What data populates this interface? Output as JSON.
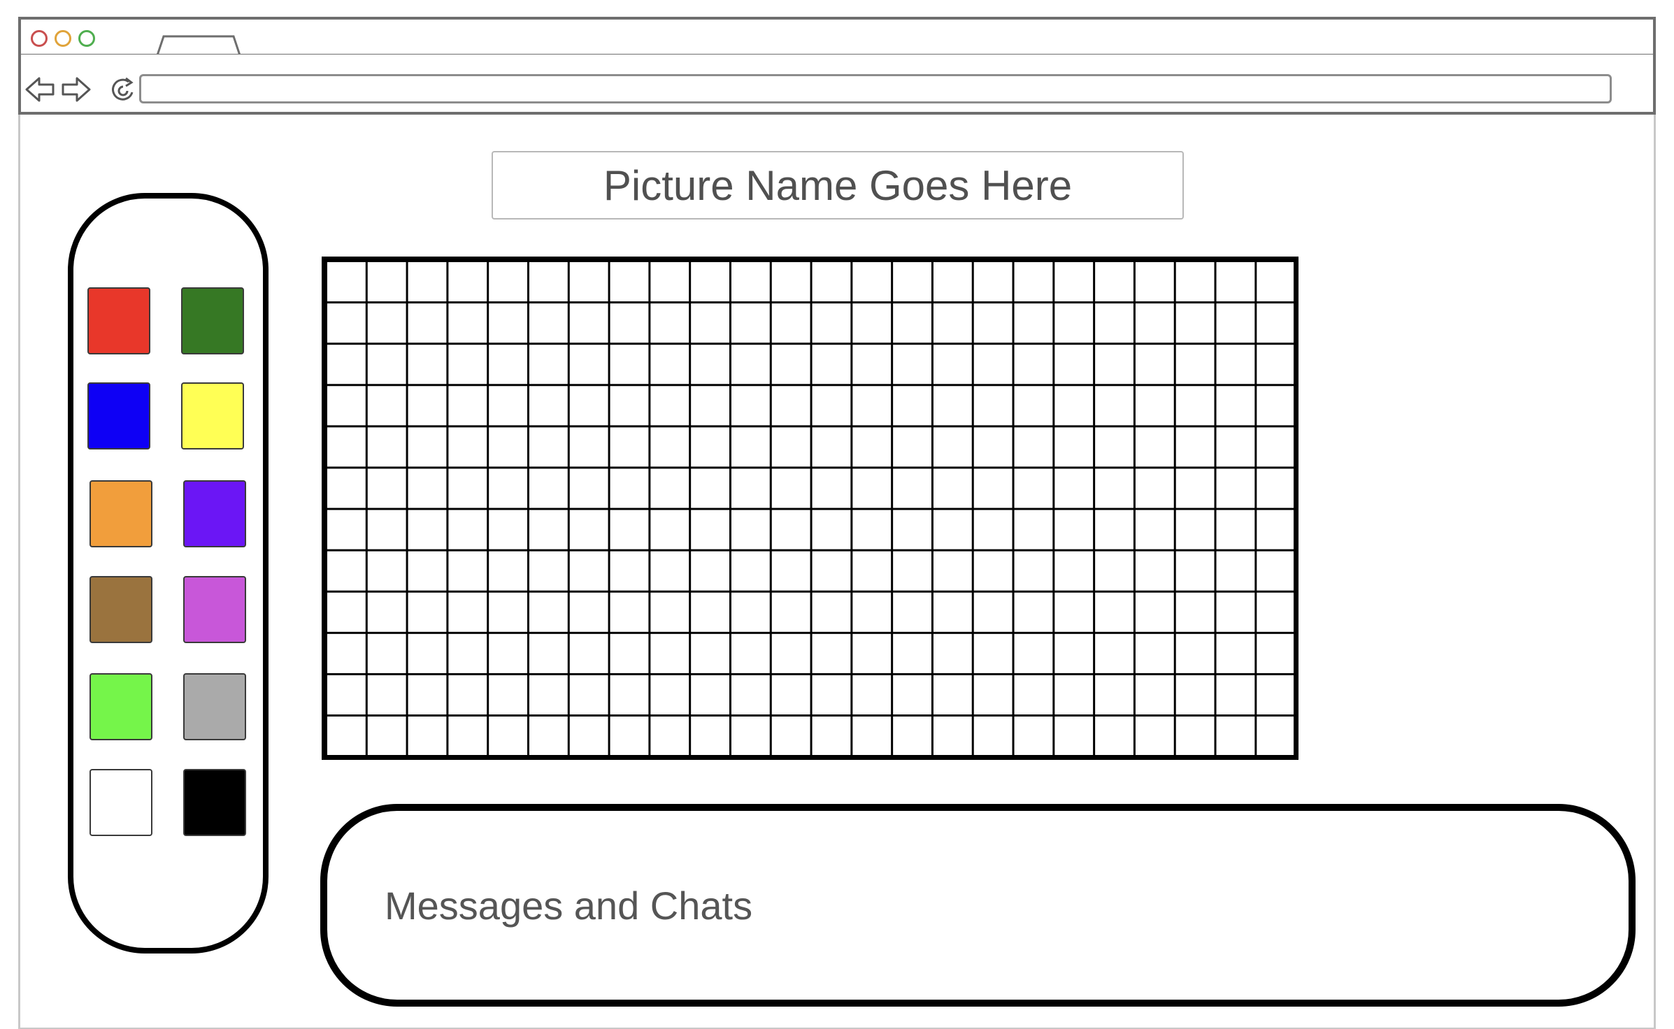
{
  "window": {
    "traffic_lights": [
      "close",
      "minimize",
      "maximize"
    ],
    "traffic_light_colors": [
      "#c94f4f",
      "#e0a33a",
      "#4fae4f"
    ]
  },
  "toolbar": {
    "back_icon": "back-arrow-icon",
    "forward_icon": "forward-arrow-icon",
    "reload_icon": "reload-icon",
    "address_value": ""
  },
  "main": {
    "picture_name": "Picture Name Goes Here",
    "messages_label": "Messages and Chats"
  },
  "palette": {
    "colors": [
      {
        "name": "red",
        "hex": "#e8372a"
      },
      {
        "name": "dark-green",
        "hex": "#367824"
      },
      {
        "name": "blue",
        "hex": "#0e00f5"
      },
      {
        "name": "yellow",
        "hex": "#ffff55"
      },
      {
        "name": "orange",
        "hex": "#f19e3c"
      },
      {
        "name": "violet",
        "hex": "#6b16f5"
      },
      {
        "name": "brown",
        "hex": "#9a733e"
      },
      {
        "name": "magenta",
        "hex": "#c857d9"
      },
      {
        "name": "light-green",
        "hex": "#75f54a"
      },
      {
        "name": "gray",
        "hex": "#aaaaaa"
      },
      {
        "name": "white",
        "hex": "#ffffff"
      },
      {
        "name": "black",
        "hex": "#000000"
      }
    ]
  },
  "canvas": {
    "columns": 24,
    "rows": 12
  }
}
